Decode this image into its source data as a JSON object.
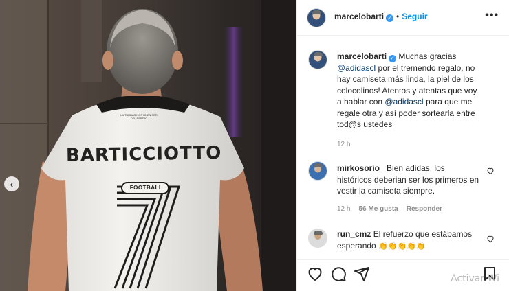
{
  "post": {
    "author": "marcelobarti",
    "follow_label": "Seguir",
    "separator": "•",
    "more_glyph": "•••",
    "prev_glyph": "‹",
    "jersey": {
      "name": "BARTICCIOTTO",
      "number": "7",
      "brand": "FOOTBALL",
      "neck_text": "LA TURBAS NOS UNEN SER DEL ESPEJO"
    }
  },
  "caption": {
    "author": "marcelobarti",
    "text_1": " Muchas gracias ",
    "mention_1": "@adidascl",
    "text_2": " por el tremendo regalo, no hay camiseta más linda, la piel de los colocolinos! Atentos y atentas que voy a hablar con ",
    "mention_2": "@adidascl",
    "text_3": " para que me regale otra y así poder sortearla entre tod@s ustedes",
    "time": "12 h"
  },
  "comments": [
    {
      "author": "mirkosorio_",
      "text": " Bien adidas, los históricos deberian ser los primeros en vestir la camiseta siempre.",
      "time": "12 h",
      "likes": "56 Me gusta",
      "reply": "Responder"
    },
    {
      "author": "run_cmz",
      "text": " El refuerzo que estábamos esperando ",
      "emoji": "👏👏👏👏👏"
    }
  ],
  "actions": {
    "like_icon": "heart-outline",
    "comment_icon": "speech-bubble",
    "share_icon": "paper-plane",
    "save_icon": "bookmark"
  },
  "colors": {
    "link": "#00376b",
    "accent": "#0095f6",
    "verified": "#3897f0",
    "muted": "#8e8e8e"
  },
  "watermark": "Activar Wi"
}
